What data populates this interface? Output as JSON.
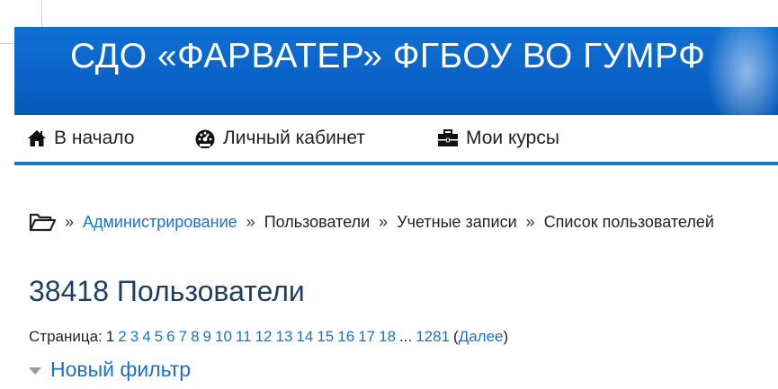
{
  "banner": {
    "title": "СДО «ФАРВАТЕР»    ФГБОУ ВО ГУМРФ"
  },
  "nav": {
    "home": {
      "label": "В начало",
      "icon": "home-icon"
    },
    "cabinet": {
      "label": "Личный кабинет",
      "icon": "dashboard-icon"
    },
    "courses": {
      "label": "Мои курсы",
      "icon": "briefcase-icon"
    }
  },
  "breadcrumb": {
    "icon": "folder-open-icon",
    "separator": "»",
    "items": [
      {
        "label": "Администрирование",
        "link": true
      },
      {
        "label": "Пользователи",
        "link": false
      },
      {
        "label": "Учетные записи",
        "link": false
      },
      {
        "label": "Список пользователей",
        "link": false
      }
    ]
  },
  "main": {
    "heading": "38418 Пользователи",
    "pagination": {
      "label": "Страница:",
      "current": "1",
      "pages": [
        "2",
        "3",
        "4",
        "5",
        "6",
        "7",
        "8",
        "9",
        "10",
        "11",
        "12",
        "13",
        "14",
        "15",
        "16",
        "17",
        "18"
      ],
      "ellipsis": "...",
      "last": "1281",
      "next_open": "(",
      "next": "Далее",
      "next_close": ")"
    },
    "filter": {
      "label": "Новый фильтр"
    }
  },
  "colors": {
    "banner": "#0a63c8",
    "link": "#1a73c8",
    "heading": "#1e3f66",
    "nav_border": "#1677cf"
  }
}
